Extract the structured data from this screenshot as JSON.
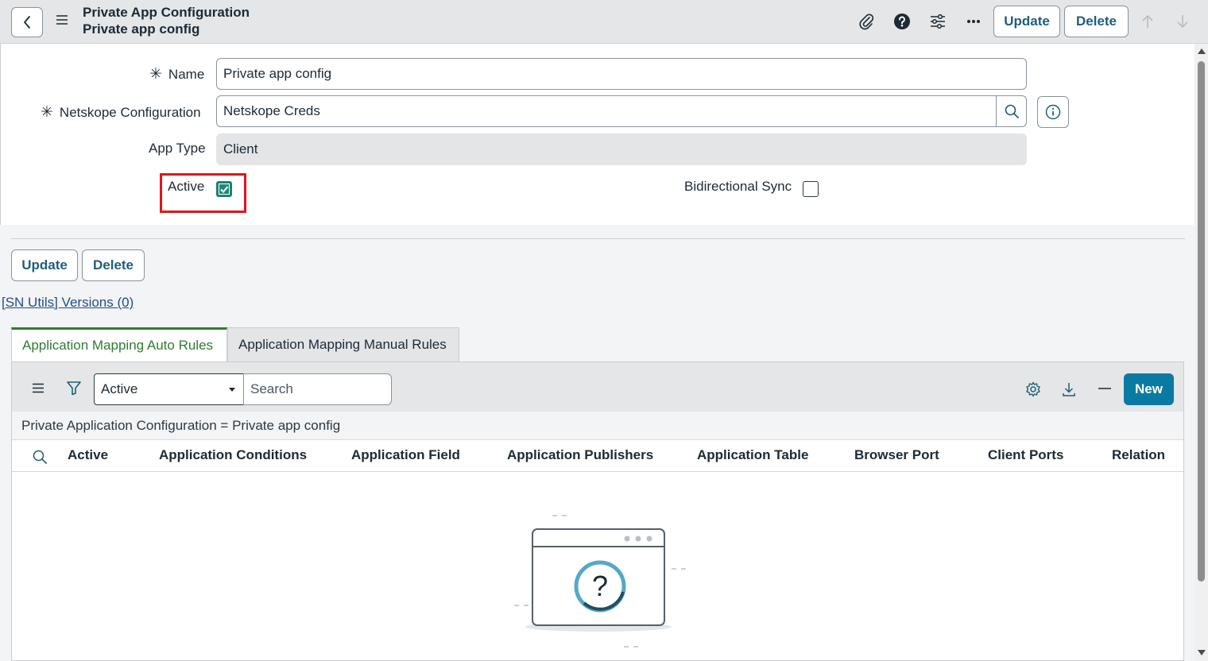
{
  "header": {
    "title": "Private App Configuration",
    "subtitle": "Private app config",
    "update_label": "Update",
    "delete_label": "Delete"
  },
  "form": {
    "name": {
      "label": "Name",
      "value": "Private app config",
      "required_mark": "✳"
    },
    "netskope_configuration": {
      "label": "Netskope Configuration",
      "value": "Netskope Creds",
      "required_mark": "✳"
    },
    "app_type": {
      "label": "App Type",
      "value": "Client"
    },
    "active": {
      "label": "Active",
      "checked": true
    },
    "bidirectional_sync": {
      "label": "Bidirectional Sync",
      "checked": false
    }
  },
  "actions": {
    "update_label": "Update",
    "delete_label": "Delete"
  },
  "versions_link": "[SN Utils] Versions (0)",
  "tabs": [
    {
      "label": "Application Mapping Auto Rules",
      "active": true
    },
    {
      "label": "Application Mapping Manual Rules",
      "active": false
    }
  ],
  "list": {
    "filter_select": "Active",
    "search_placeholder": "Search",
    "new_label": "New",
    "breadcrumb": "Private Application Configuration = Private app config",
    "columns": [
      "Active",
      "Application Conditions",
      "Application Field",
      "Application Publishers",
      "Application Table",
      "Browser Port",
      "Client Ports",
      "Relation"
    ]
  },
  "icons": {
    "back": "chevron-left-icon",
    "menu": "hamburger-icon",
    "attachment": "paperclip-icon",
    "help": "question-circle-icon",
    "settings": "sliders-icon",
    "more": "ellipsis-icon",
    "nav_up": "arrow-up-icon",
    "nav_down": "arrow-down-icon",
    "lookup": "search-icon",
    "info": "info-icon",
    "filter": "funnel-icon",
    "gear": "gear-icon",
    "download": "download-icon",
    "collapse": "minus-icon"
  },
  "colors": {
    "accent": "#0b7aa3",
    "tab_active": "#2e7d32",
    "highlight": "#e0161b",
    "checkbox_checked": "#1e8a79"
  }
}
